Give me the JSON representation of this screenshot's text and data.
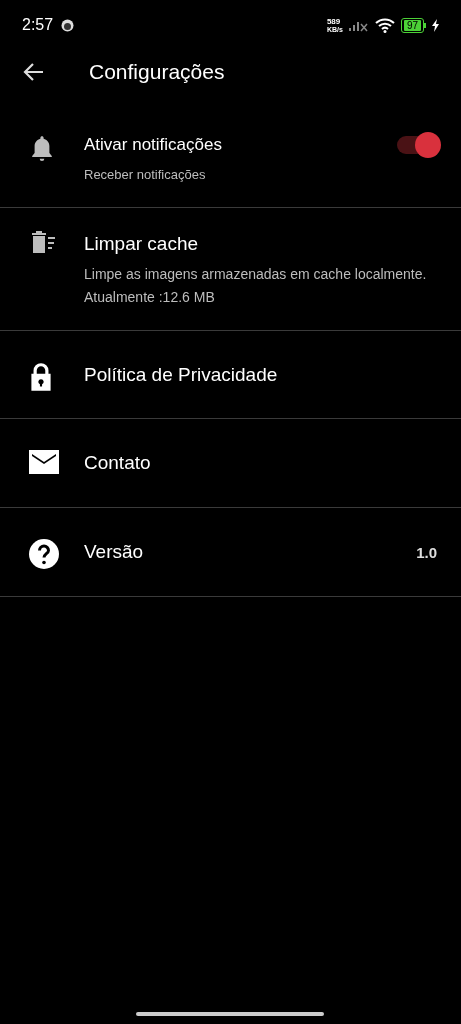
{
  "status_bar": {
    "time": "2:57",
    "speed": "589",
    "speed_unit": "KB/s",
    "battery": "97"
  },
  "header": {
    "title": "Configurações"
  },
  "settings": [
    {
      "kind": "toggle",
      "title": "Ativar notificações",
      "subtitle": "Receber notificações",
      "on": true
    },
    {
      "kind": "info",
      "title": "Limpar cache",
      "subtitle": "Limpe as imagens armazenadas em cache localmente.",
      "detail": "Atualmente :12.6 MB"
    },
    {
      "kind": "link",
      "title": "Política de Privacidade"
    },
    {
      "kind": "link",
      "title": "Contato"
    },
    {
      "kind": "value",
      "title": "Versão",
      "value": "1.0"
    }
  ]
}
